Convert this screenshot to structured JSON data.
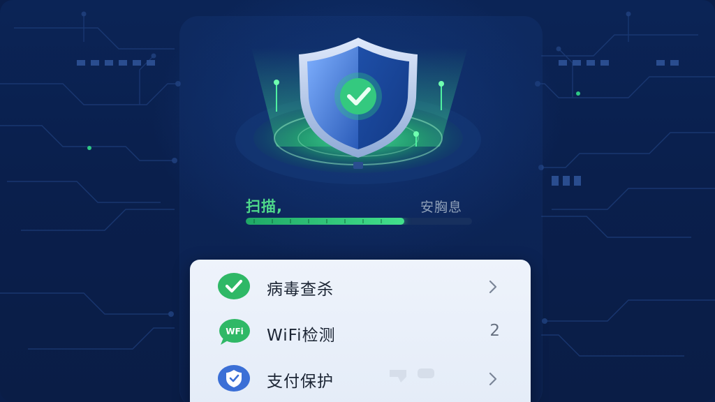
{
  "scan": {
    "label": "扫描,",
    "status": "安胸息",
    "progress": 0.7
  },
  "menu": {
    "items": [
      {
        "label": "病毒查杀",
        "icon": "check-circle-icon",
        "trailing": ""
      },
      {
        "label": "WiFi检测",
        "icon": "wifi-bubble-icon",
        "trailing": "2"
      },
      {
        "label": "支付保护",
        "icon": "shield-check-icon",
        "trailing": ""
      }
    ],
    "wifi_icon_text": "WFi"
  },
  "colors": {
    "accent_green": "#3ed287",
    "shield_blue": "#2f62c0",
    "background": "#0a1e4a",
    "card": "#eaf0fa"
  }
}
